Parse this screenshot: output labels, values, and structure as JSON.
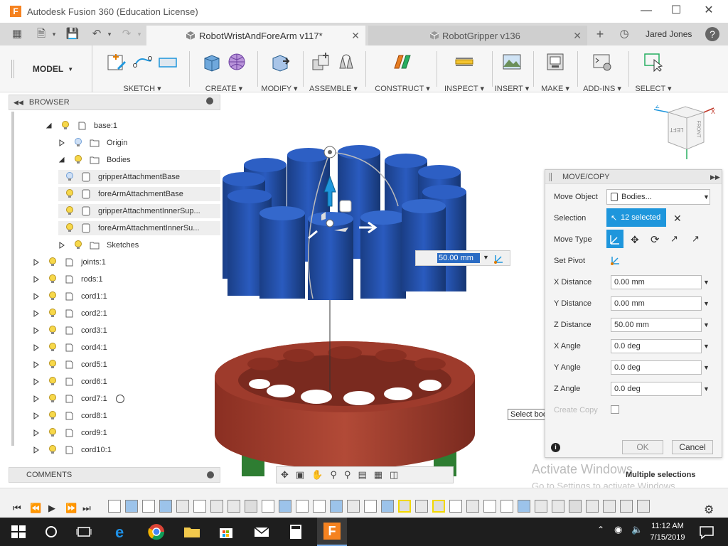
{
  "window": {
    "title": "Autodesk Fusion 360 (Education License)",
    "app_icon": "F"
  },
  "tabs": [
    {
      "label": "RobotWristAndForeArm v117*",
      "active": true
    },
    {
      "label": "RobotGripper v136",
      "active": false
    }
  ],
  "user": {
    "name": "Jared Jones"
  },
  "toolbar": {
    "workspace": "MODEL",
    "groups": [
      "SKETCH",
      "CREATE",
      "MODIFY",
      "ASSEMBLE",
      "CONSTRUCT",
      "INSPECT",
      "INSERT",
      "MAKE",
      "ADD-INS",
      "SELECT"
    ]
  },
  "browser": {
    "title": "BROWSER",
    "items": [
      {
        "label": "base:1"
      },
      {
        "label": "Origin"
      },
      {
        "label": "Bodies"
      },
      {
        "label": "gripperAttachmentBase"
      },
      {
        "label": "foreArmAttachmentBase"
      },
      {
        "label": "gripperAttachmentInnerSup..."
      },
      {
        "label": "foreArmAttachmentInnerSu..."
      },
      {
        "label": "Sketches"
      },
      {
        "label": "joints:1"
      },
      {
        "label": "rods:1"
      },
      {
        "label": "cord1:1"
      },
      {
        "label": "cord2:1"
      },
      {
        "label": "cord3:1"
      },
      {
        "label": "cord4:1"
      },
      {
        "label": "cord5:1"
      },
      {
        "label": "cord6:1"
      },
      {
        "label": "cord7:1"
      },
      {
        "label": "cord8:1"
      },
      {
        "label": "cord9:1"
      },
      {
        "label": "cord10:1"
      }
    ]
  },
  "comments": {
    "title": "COMMENTS"
  },
  "viewport": {
    "distance_input": "50.00 mm",
    "tooltip": "Select bodies to move",
    "activate_title": "Activate Windows",
    "activate_sub": "Go to Settings to activate Windows.",
    "multiple_selections": "Multiple selections"
  },
  "viewcube": {
    "left": "LEFT",
    "front": "FRONT"
  },
  "movecopy": {
    "title": "MOVE/COPY",
    "move_object_label": "Move Object",
    "move_object_value": "Bodies...",
    "selection_label": "Selection",
    "selection_value": "12 selected",
    "move_type_label": "Move Type",
    "set_pivot_label": "Set Pivot",
    "x_distance_label": "X Distance",
    "x_distance": "0.00 mm",
    "y_distance_label": "Y Distance",
    "y_distance": "0.00 mm",
    "z_distance_label": "Z Distance",
    "z_distance": "50.00 mm",
    "x_angle_label": "X Angle",
    "x_angle": "0.0 deg",
    "y_angle_label": "Y Angle",
    "y_angle": "0.0 deg",
    "z_angle_label": "Z Angle",
    "z_angle": "0.0 deg",
    "create_copy_label": "Create Copy",
    "ok": "OK",
    "cancel": "Cancel"
  },
  "taskbar": {
    "time": "11:12 AM",
    "date": "7/15/2019"
  },
  "colors": {
    "accent": "#1e96dc",
    "cylinder": "#1f4fa6",
    "ring": "#a6402f",
    "gear": "#2e7d32"
  }
}
